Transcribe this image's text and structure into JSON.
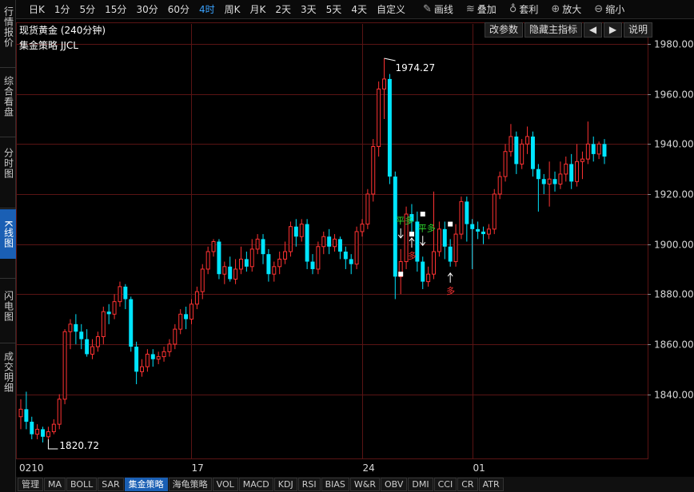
{
  "toolbar": {
    "timeframes": [
      "日K",
      "1分",
      "5分",
      "15分",
      "30分",
      "60分",
      "4时",
      "周K",
      "月K",
      "2天",
      "3天",
      "5天",
      "4天",
      "自定义"
    ],
    "active_timeframe": "4时",
    "tools": [
      {
        "label": "画线",
        "icon": "pencil-icon",
        "glyph": "✎"
      },
      {
        "label": "叠加",
        "icon": "layers-icon",
        "glyph": "≋"
      },
      {
        "label": "套利",
        "icon": "money-bag-icon",
        "glyph": "♁"
      },
      {
        "label": "放大",
        "icon": "zoom-in-icon",
        "glyph": "⊕"
      },
      {
        "label": "缩小",
        "icon": "zoom-out-icon",
        "glyph": "⊖"
      }
    ]
  },
  "left_nav": [
    {
      "label": "行情报价",
      "active": false
    },
    {
      "label": "综合看盘",
      "active": false
    },
    {
      "label": "分时图",
      "active": false
    },
    {
      "label": "K线图",
      "active": true
    },
    {
      "label": "闪电图",
      "active": false
    },
    {
      "label": "成交明细",
      "active": false
    }
  ],
  "header": {
    "title": "现货黄金 (240分钟)",
    "strategy": "集金策略 JJCL",
    "buttons": {
      "params": "改参数",
      "hide_indicator": "隐藏主指标",
      "prev": "◀",
      "next": "▶",
      "help": "说明"
    }
  },
  "bottom_tabs": [
    "管理",
    "MA",
    "BOLL",
    "SAR",
    "集金策略",
    "海龟策略",
    "VOL",
    "MACD",
    "KDJ",
    "RSI",
    "BIAS",
    "W&R",
    "OBV",
    "DMI",
    "CCI",
    "CR",
    "ATR"
  ],
  "active_bottom_tab": "集金策略",
  "colors": {
    "up": "#ff3232",
    "down": "#00e5ff",
    "grid": "#5a1414",
    "axis_text": "#d8d8d8",
    "signal_green": "#2ed82e",
    "signal_red": "#ff3232"
  },
  "chart_data": {
    "type": "candlestick",
    "ylim": [
      1814,
      1988
    ],
    "y_ticks": [
      "1840.00",
      "1860.00",
      "1880.00",
      "1900.00",
      "1920.00",
      "1940.00",
      "1960.00",
      "1980.00"
    ],
    "x_ticks": [
      {
        "label": "0210",
        "index": 0
      },
      {
        "label": "17",
        "index": 31
      },
      {
        "label": "24",
        "index": 62
      },
      {
        "label": "01",
        "index": 82
      }
    ],
    "high_annotation": {
      "label": "1974.27",
      "index": 66
    },
    "low_annotation": {
      "label": "1820.72",
      "index": 5
    },
    "candles": [
      [
        1831,
        1834,
        1826,
        1838
      ],
      [
        1834,
        1829,
        1826,
        1841
      ],
      [
        1829,
        1824,
        1822,
        1831
      ],
      [
        1824,
        1826,
        1822,
        1828
      ],
      [
        1826,
        1823,
        1820.72,
        1827
      ],
      [
        1823,
        1825,
        1822,
        1827
      ],
      [
        1825,
        1828,
        1824,
        1830
      ],
      [
        1828,
        1838,
        1826,
        1840
      ],
      [
        1838,
        1865,
        1836,
        1866
      ],
      [
        1865,
        1868,
        1858,
        1870
      ],
      [
        1868,
        1865,
        1860,
        1872
      ],
      [
        1865,
        1862,
        1858,
        1868
      ],
      [
        1862,
        1856,
        1855,
        1866
      ],
      [
        1856,
        1859,
        1854,
        1862
      ],
      [
        1859,
        1863,
        1857,
        1865
      ],
      [
        1863,
        1873,
        1860,
        1875
      ],
      [
        1873,
        1872,
        1868,
        1876
      ],
      [
        1872,
        1877,
        1870,
        1880
      ],
      [
        1877,
        1883,
        1875,
        1885
      ],
      [
        1883,
        1878,
        1874,
        1884
      ],
      [
        1878,
        1859,
        1857,
        1879
      ],
      [
        1859,
        1849,
        1844,
        1861
      ],
      [
        1849,
        1851,
        1847,
        1854
      ],
      [
        1851,
        1856,
        1849,
        1858
      ],
      [
        1856,
        1854,
        1851,
        1858
      ],
      [
        1854,
        1855,
        1852,
        1857
      ],
      [
        1855,
        1857,
        1853,
        1859
      ],
      [
        1857,
        1860,
        1855,
        1862
      ],
      [
        1860,
        1866,
        1858,
        1868
      ],
      [
        1866,
        1872,
        1864,
        1874
      ],
      [
        1872,
        1870,
        1866,
        1875
      ],
      [
        1870,
        1876,
        1868,
        1878
      ],
      [
        1876,
        1881,
        1874,
        1883
      ],
      [
        1881,
        1890,
        1878,
        1892
      ],
      [
        1890,
        1897,
        1888,
        1899
      ],
      [
        1897,
        1901,
        1895,
        1902
      ],
      [
        1901,
        1888,
        1886,
        1902
      ],
      [
        1888,
        1891,
        1884,
        1893
      ],
      [
        1891,
        1886,
        1885,
        1895
      ],
      [
        1886,
        1890,
        1884,
        1894
      ],
      [
        1890,
        1894,
        1888,
        1899
      ],
      [
        1894,
        1891,
        1889,
        1897
      ],
      [
        1891,
        1898,
        1889,
        1902
      ],
      [
        1898,
        1902,
        1896,
        1904
      ],
      [
        1902,
        1896,
        1892,
        1904
      ],
      [
        1896,
        1888,
        1885,
        1898
      ],
      [
        1888,
        1891,
        1885,
        1893
      ],
      [
        1891,
        1894,
        1888,
        1897
      ],
      [
        1894,
        1897,
        1892,
        1901
      ],
      [
        1897,
        1907,
        1895,
        1909
      ],
      [
        1907,
        1903,
        1899,
        1910
      ],
      [
        1903,
        1908,
        1901,
        1910
      ],
      [
        1908,
        1893,
        1890,
        1910
      ],
      [
        1893,
        1890,
        1888,
        1896
      ],
      [
        1890,
        1899,
        1888,
        1901
      ],
      [
        1899,
        1903,
        1896,
        1905
      ],
      [
        1903,
        1899,
        1896,
        1906
      ],
      [
        1899,
        1902,
        1897,
        1904
      ],
      [
        1902,
        1897,
        1894,
        1903
      ],
      [
        1897,
        1894,
        1890,
        1899
      ],
      [
        1894,
        1892,
        1888,
        1896
      ],
      [
        1892,
        1905,
        1890,
        1907
      ],
      [
        1905,
        1908,
        1903,
        1910
      ],
      [
        1908,
        1920,
        1906,
        1922
      ],
      [
        1920,
        1939,
        1917,
        1942
      ],
      [
        1939,
        1962,
        1935,
        1965
      ],
      [
        1962,
        1966,
        1950,
        1974.27
      ],
      [
        1966,
        1927,
        1924,
        1968
      ],
      [
        1927,
        1887,
        1878,
        1929
      ],
      [
        1887,
        1893,
        1880,
        1898
      ],
      [
        1893,
        1912,
        1890,
        1915
      ],
      [
        1912,
        1909,
        1905,
        1916
      ],
      [
        1909,
        1893,
        1889,
        1913
      ],
      [
        1893,
        1885,
        1882,
        1895
      ],
      [
        1885,
        1888,
        1883,
        1891
      ],
      [
        1888,
        1897,
        1886,
        1921
      ],
      [
        1897,
        1906,
        1895,
        1909
      ],
      [
        1906,
        1899,
        1894,
        1909
      ],
      [
        1899,
        1893,
        1891,
        1902
      ],
      [
        1893,
        1904,
        1891,
        1908
      ],
      [
        1904,
        1917,
        1902,
        1919
      ],
      [
        1917,
        1908,
        1901,
        1919
      ],
      [
        1908,
        1906,
        1890,
        1910
      ],
      [
        1906,
        1905,
        1902,
        1909
      ],
      [
        1905,
        1904,
        1900,
        1907
      ],
      [
        1904,
        1906,
        1902,
        1908
      ],
      [
        1906,
        1920,
        1904,
        1922
      ],
      [
        1920,
        1927,
        1918,
        1929
      ],
      [
        1927,
        1937,
        1925,
        1940
      ],
      [
        1937,
        1943,
        1935,
        1948
      ],
      [
        1943,
        1932,
        1928,
        1945
      ],
      [
        1932,
        1940,
        1930,
        1942
      ],
      [
        1940,
        1943,
        1936,
        1947
      ],
      [
        1943,
        1930,
        1927,
        1945
      ],
      [
        1930,
        1926,
        1913,
        1932
      ],
      [
        1926,
        1924,
        1920,
        1928
      ],
      [
        1924,
        1926,
        1915,
        1933
      ],
      [
        1926,
        1924,
        1921,
        1929
      ],
      [
        1924,
        1928,
        1922,
        1933
      ],
      [
        1928,
        1932,
        1925,
        1935
      ],
      [
        1932,
        1925,
        1922,
        1936
      ],
      [
        1925,
        1933,
        1923,
        1940
      ],
      [
        1933,
        1934,
        1926,
        1937
      ],
      [
        1934,
        1940,
        1932,
        1949
      ],
      [
        1940,
        1936,
        1933,
        1943
      ],
      [
        1936,
        1940,
        1934,
        1941
      ],
      [
        1940,
        1935,
        1932,
        1942
      ]
    ],
    "signals": [
      {
        "index": 69,
        "label": "平多",
        "kind": "sell",
        "color": "green",
        "marker_price": 1888
      },
      {
        "index": 71,
        "label": "多",
        "kind": "buy",
        "color": "red",
        "marker_price": 1904
      },
      {
        "index": 73,
        "label": "平多",
        "kind": "sell",
        "color": "green",
        "marker_price": 1912
      },
      {
        "index": 78,
        "label": "多",
        "kind": "buy",
        "color": "red",
        "marker_price": 1908
      }
    ]
  }
}
